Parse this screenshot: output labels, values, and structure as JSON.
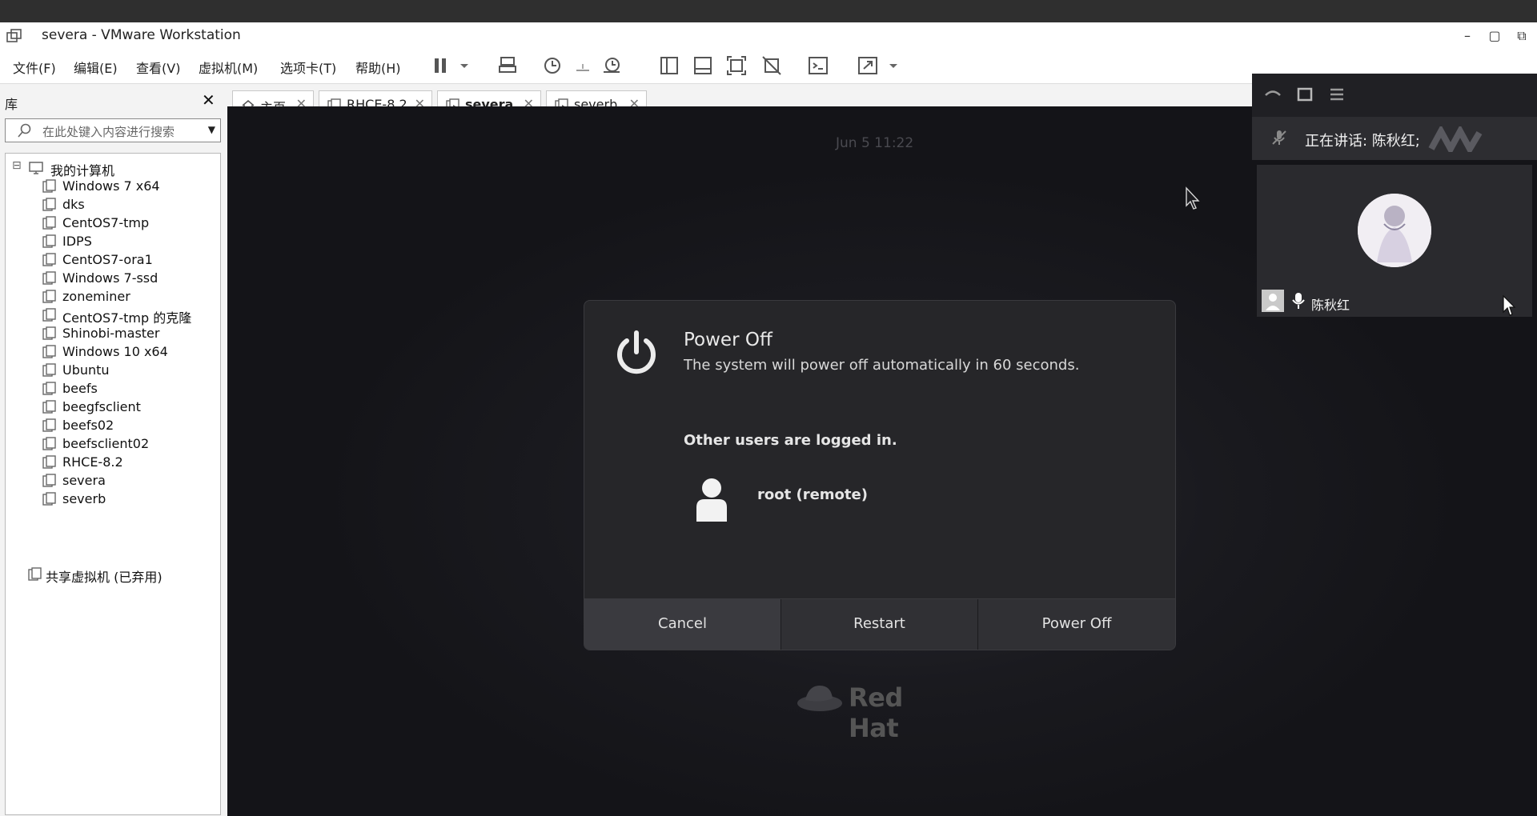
{
  "titlebar": {
    "title": "severa - VMware Workstation",
    "buttons": [
      "–",
      "▢",
      "⧉"
    ]
  },
  "menu": {
    "items": [
      "文件(F)",
      "编辑(E)",
      "查看(V)",
      "虚拟机(M)",
      "选项卡(T)",
      "帮助(H)"
    ]
  },
  "toolbar": {
    "icons": [
      "pause-icon",
      "dropdown-icon",
      "send-keys-icon",
      "snapshot-icon",
      "snapshot-restore-icon",
      "snapshot-manager-icon",
      "library-view-icon",
      "thumbnail-view-icon",
      "fit-guest-icon",
      "unity-icon",
      "console-icon",
      "fullscreen-icon",
      "fullscreen-dropdown-icon"
    ]
  },
  "library": {
    "title": "库",
    "close": "✕",
    "search_placeholder": "在此处键入内容进行搜索",
    "root_label": "我的计算机",
    "root_expander": "⊟",
    "items": [
      "Windows 7 x64",
      "dks",
      "CentOS7-tmp",
      "IDPS",
      "CentOS7-ora1",
      "Windows 7-ssd",
      "zoneminer",
      "CentOS7-tmp 的克隆",
      "Shinobi-master",
      "Windows 10 x64",
      "Ubuntu",
      "beefs",
      "beegfsclient",
      "beefs02",
      "beefsclient02",
      "RHCE-8.2",
      "severa",
      "severb"
    ],
    "shared_label": "共享虚拟机 (已弃用)"
  },
  "tabs": [
    {
      "label": "主页",
      "close": "✕",
      "icon": "home-icon",
      "active": false
    },
    {
      "label": "RHCE-8.2",
      "close": "✕",
      "icon": "vm-icon",
      "active": false
    },
    {
      "label": "severa",
      "close": "✕",
      "icon": "vm-running-icon",
      "active": true
    },
    {
      "label": "severb",
      "close": "✕",
      "icon": "vm-running-icon",
      "active": false
    }
  ],
  "vm": {
    "clock": "Jun 5  11:22",
    "dialog": {
      "title": "Power Off",
      "subtitle": "The system will power off automatically in 60 seconds.",
      "users_heading": "Other users are logged in.",
      "user": "root (remote)",
      "buttons": [
        "Cancel",
        "Restart",
        "Power Off"
      ]
    },
    "brand": "Red Hat"
  },
  "meeting": {
    "speaking_label": "正在讲话: 陈秋红;",
    "participant_name": "陈秋红"
  },
  "colors": {
    "vm_background": "#141418",
    "dialog_background": "#262629",
    "overlay_background": "#202024"
  }
}
